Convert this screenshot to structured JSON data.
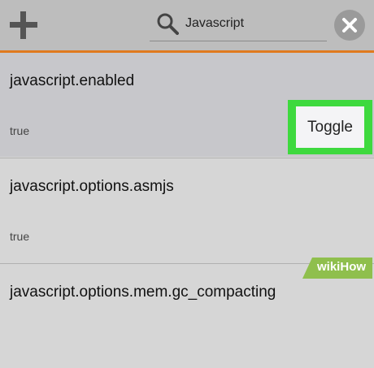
{
  "toolbar": {
    "add_icon": "plus-icon",
    "search": {
      "icon": "magnifier-icon",
      "value": "Javascript"
    },
    "clear_icon": "close-icon",
    "accent_color": "#e07a1f"
  },
  "preferences": [
    {
      "name": "javascript.enabled",
      "value": "true",
      "action": "Toggle"
    },
    {
      "name": "javascript.options.asmjs",
      "value": "true"
    },
    {
      "name": "javascript.options.mem.gc_compacting"
    }
  ],
  "highlight_color": "#3ed93e",
  "watermark": {
    "brand_a": "wiki",
    "brand_b": "How"
  }
}
